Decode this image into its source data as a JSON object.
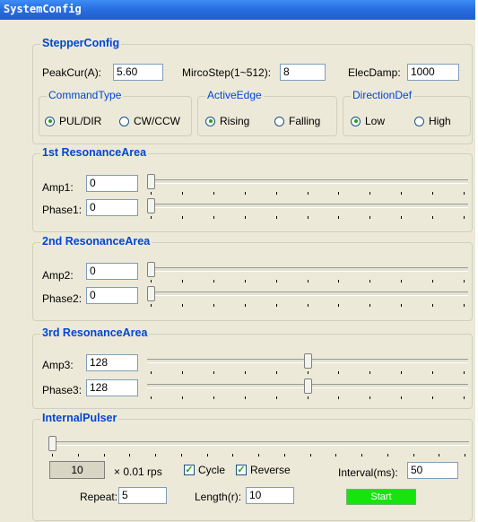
{
  "window": {
    "title": "SystemConfig"
  },
  "stepper": {
    "title": "StepperConfig",
    "peakcur_label": "PeakCur(A):",
    "peakcur_value": "5.60",
    "microstep_label": "MircoStep(1~512):",
    "microstep_value": "8",
    "elecdamp_label": "ElecDamp:",
    "elecdamp_value": "1000",
    "command_type": {
      "title": "CommandType",
      "opt1": "PUL/DIR",
      "opt2": "CW/CCW",
      "selected": "PUL/DIR"
    },
    "active_edge": {
      "title": "ActiveEdge",
      "opt1": "Rising",
      "opt2": "Falling",
      "selected": "Rising"
    },
    "direction_def": {
      "title": "DirectionDef",
      "opt1": "Low",
      "opt2": "High",
      "selected": "Low"
    }
  },
  "res1": {
    "title": "1st ResonanceArea",
    "amp_label": "Amp1:",
    "amp_value": "0",
    "phase_label": "Phase1:",
    "phase_value": "0",
    "amp_level": 0,
    "phase_level": 0
  },
  "res2": {
    "title": "2nd ResonanceArea",
    "amp_label": "Amp2:",
    "amp_value": "0",
    "phase_label": "Phase2:",
    "phase_value": "0",
    "amp_level": 0,
    "phase_level": 0
  },
  "res3": {
    "title": "3rd ResonanceArea",
    "amp_label": "Amp3:",
    "amp_value": "128",
    "phase_label": "Phase3:",
    "phase_value": "128",
    "amp_level": 0.5,
    "phase_level": 0.5
  },
  "pulser": {
    "title": "InternalPulser",
    "speed_value": "10",
    "unit_label": "× 0.01 rps",
    "cycle_label": "Cycle",
    "cycle_checked": true,
    "reverse_label": "Reverse",
    "reverse_checked": true,
    "interval_label": "Interval(ms):",
    "interval_value": "50",
    "repeat_label": "Repeat:",
    "repeat_value": "5",
    "length_label": "Length(r):",
    "length_value": "10",
    "start_label": "Start",
    "slider_level": 0
  },
  "colors": {
    "group_title": "#0046d5",
    "start_button": "#17e40f",
    "titlebar": "#2a6fe0"
  }
}
